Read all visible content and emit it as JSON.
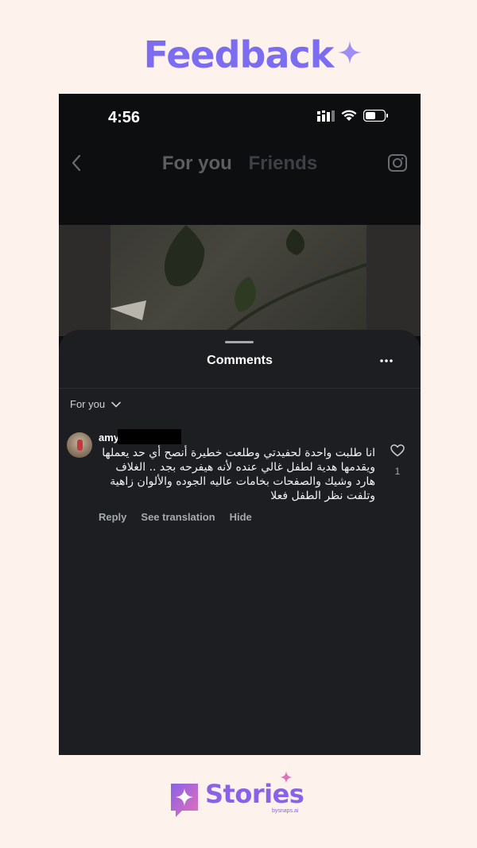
{
  "headline": {
    "text": "Feedback"
  },
  "status_bar": {
    "time": "4:56"
  },
  "top_nav": {
    "tab_for_you": "For you",
    "tab_friends": "Friends"
  },
  "comments_sheet": {
    "title": "Comments",
    "filter_label": "For you"
  },
  "comment": {
    "username": "amy",
    "text_lines": [
      "انا طلبت واحدة لحفيدتي وطلعت خطيرة أنصح أي حد يعملها",
      "ويقدمها هدية لطفل غالي عنده لأنه هيفرحه بجد .. الغلاف",
      "هارد وشيك والصفحات بخامات عاليه الجوده والألوان زاهية",
      "وتلفت نظر الطفل فعلا"
    ],
    "like_count": "1",
    "actions": {
      "reply": "Reply",
      "see_translation": "See translation",
      "hide": "Hide"
    }
  },
  "brand": {
    "name": "Stories",
    "tagline": "bysnaps.ai"
  },
  "colors": {
    "accent": "#7c6cf0",
    "background": "#fdf3ec",
    "sheet": "#1c1e21",
    "phone": "#0c0e10"
  },
  "icons": [
    "sparkle-icon",
    "signal-icon",
    "wifi-icon",
    "battery-icon",
    "back-chevron-icon",
    "camera-icon",
    "more-icon",
    "chevron-down-icon",
    "heart-icon"
  ]
}
